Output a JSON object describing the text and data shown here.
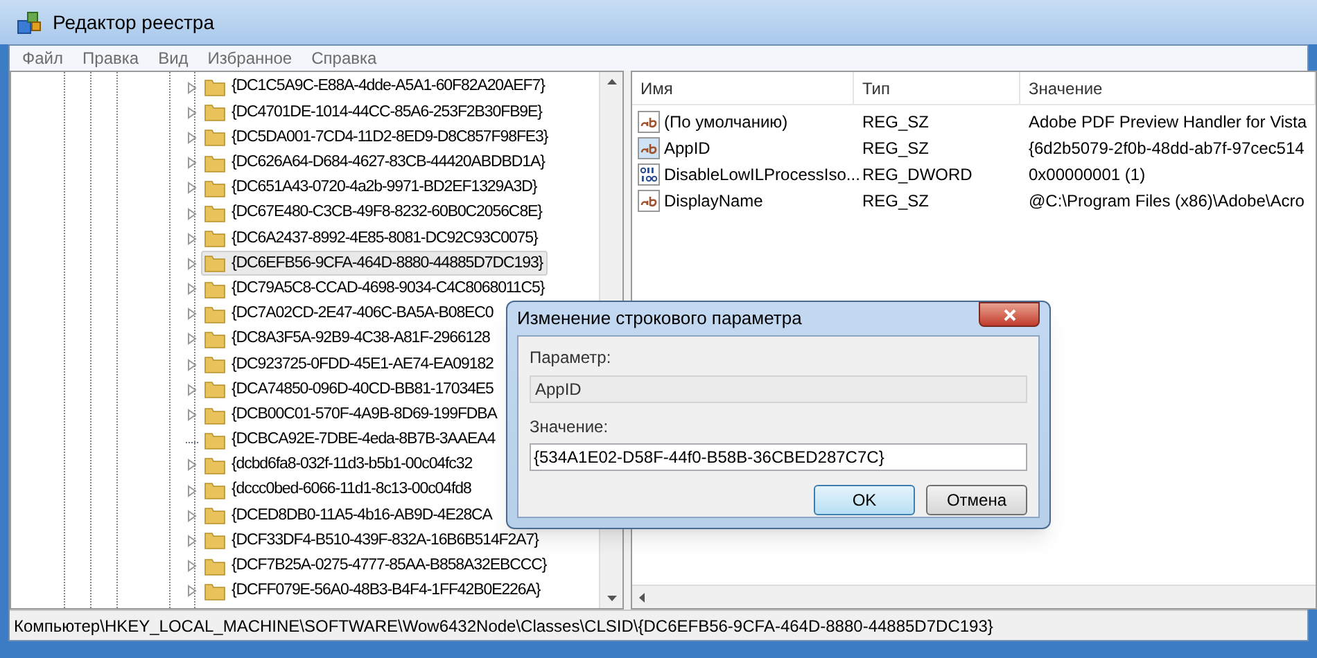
{
  "window": {
    "title": "Редактор реестра"
  },
  "menu": [
    "Файл",
    "Правка",
    "Вид",
    "Избранное",
    "Справка"
  ],
  "tree": {
    "items": [
      {
        "label": "{DC1C5A9C-E88A-4dde-A5A1-60F82A20AEF7}",
        "expandable": true,
        "selected": false
      },
      {
        "label": "{DC4701DE-1014-44CC-85A6-253F2B30FB9E}",
        "expandable": true,
        "selected": false
      },
      {
        "label": "{DC5DA001-7CD4-11D2-8ED9-D8C857F98FE3}",
        "expandable": true,
        "selected": false
      },
      {
        "label": "{DC626A64-D684-4627-83CB-44420ABDBD1A}",
        "expandable": true,
        "selected": false
      },
      {
        "label": "{DC651A43-0720-4a2b-9971-BD2EF1329A3D}",
        "expandable": true,
        "selected": false
      },
      {
        "label": "{DC67E480-C3CB-49F8-8232-60B0C2056C8E}",
        "expandable": true,
        "selected": false
      },
      {
        "label": "{DC6A2437-8992-4E85-8081-DC92C93C0075}",
        "expandable": true,
        "selected": false
      },
      {
        "label": "{DC6EFB56-9CFA-464D-8880-44885D7DC193}",
        "expandable": true,
        "selected": true
      },
      {
        "label": "{DC79A5C8-CCAD-4698-9034-C4C8068011C5}",
        "expandable": true,
        "selected": false
      },
      {
        "label": "{DC7A02CD-2E47-406C-BA5A-B08EC0",
        "expandable": true,
        "selected": false
      },
      {
        "label": "{DC8A3F5A-92B9-4C38-A81F-2966128",
        "expandable": true,
        "selected": false
      },
      {
        "label": "{DC923725-0FDD-45E1-AE74-EA09182",
        "expandable": true,
        "selected": false
      },
      {
        "label": "{DCA74850-096D-40CD-BB81-17034E5",
        "expandable": true,
        "selected": false
      },
      {
        "label": "{DCB00C01-570F-4A9B-8D69-199FDBA",
        "expandable": true,
        "selected": false
      },
      {
        "label": "{DCBCA92E-7DBE-4eda-8B7B-3AAEA4",
        "expandable": false,
        "selected": false
      },
      {
        "label": "{dcbd6fa8-032f-11d3-b5b1-00c04fc32",
        "expandable": true,
        "selected": false
      },
      {
        "label": "{dccc0bed-6066-11d1-8c13-00c04fd8",
        "expandable": true,
        "selected": false
      },
      {
        "label": "{DCED8DB0-11A5-4b16-AB9D-4E28CA",
        "expandable": true,
        "selected": false
      },
      {
        "label": "{DCF33DF4-B510-439F-832A-16B6B514F2A7}",
        "expandable": true,
        "selected": false
      },
      {
        "label": "{DCF7B25A-0275-4777-85AA-B858A32EBCCC}",
        "expandable": true,
        "selected": false
      },
      {
        "label": "{DCFF079E-56A0-48B3-B4F4-1FF42B0E226A}",
        "expandable": true,
        "selected": false
      }
    ]
  },
  "values": {
    "columns": [
      "Имя",
      "Тип",
      "Значение"
    ],
    "rows": [
      {
        "kind": "string",
        "name": "(По умолчанию)",
        "type": "REG_SZ",
        "data": "Adobe PDF Preview Handler for Vista",
        "selected": false
      },
      {
        "kind": "string",
        "name": "AppID",
        "type": "REG_SZ",
        "data": "{6d2b5079-2f0b-48dd-ab7f-97cec514",
        "selected": true
      },
      {
        "kind": "binary",
        "name": "DisableLowILProcessIso...",
        "type": "REG_DWORD",
        "data": "0x00000001 (1)",
        "selected": false
      },
      {
        "kind": "string",
        "name": "DisplayName",
        "type": "REG_SZ",
        "data": "@C:\\Program Files (x86)\\Adobe\\Acro",
        "selected": false
      }
    ]
  },
  "dialog": {
    "title": "Изменение строкового параметра",
    "param_label": "Параметр:",
    "param_value": "AppID",
    "value_label": "Значение:",
    "value": "{534A1E02-D58F-44f0-B58B-36CBED287C7C}",
    "buttons": [
      {
        "label": "OK",
        "default": true
      },
      {
        "label": "Отмена",
        "default": false
      }
    ]
  },
  "status_bar": "Компьютер\\HKEY_LOCAL_MACHINE\\SOFTWARE\\Wow6432Node\\Classes\\CLSID\\{DC6EFB56-9CFA-464D-8880-44885D7DC193}"
}
